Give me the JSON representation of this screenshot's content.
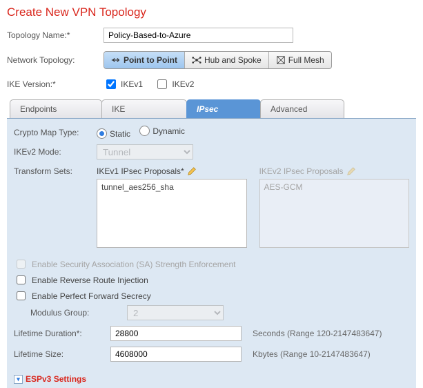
{
  "title": "Create New VPN Topology",
  "formlabels": {
    "topology_name": "Topology Name:*",
    "network_topology": "Network Topology:",
    "ike_version": "IKE Version:*"
  },
  "topology_name_value": "Policy-Based-to-Azure",
  "segments": {
    "ptp": "Point to Point",
    "hub": "Hub and Spoke",
    "full": "Full Mesh"
  },
  "ikev": {
    "v1": "IKEv1",
    "v2": "IKEv2"
  },
  "tabs": {
    "endpoints": "Endpoints",
    "ike": "IKE",
    "ipsec": "IPsec",
    "advanced": "Advanced"
  },
  "panel": {
    "crypto_map_label": "Crypto Map Type:",
    "crypto_static": "Static",
    "crypto_dynamic": "Dynamic",
    "ikev2_mode_label": "IKEv2 Mode:",
    "ikev2_mode_value": "Tunnel",
    "transform_sets_label": "Transform Sets:",
    "ikev1_prop_label": "IKEv1 IPsec Proposals*",
    "ikev2_prop_label": "IKEv2 IPsec Proposals",
    "ikev1_prop_item": "tunnel_aes256_sha",
    "ikev2_prop_item": "AES-GCM",
    "sa_enforce": "Enable Security Association (SA) Strength Enforcement",
    "rri": "Enable Reverse Route Injection",
    "pfs": "Enable Perfect Forward Secrecy",
    "modulus_label": "Modulus Group:",
    "modulus_value": "2",
    "lifetime_dur_label": "Lifetime Duration*:",
    "lifetime_dur_value": "28800",
    "lifetime_dur_unit": "Seconds (Range 120-2147483647)",
    "lifetime_size_label": "Lifetime Size:",
    "lifetime_size_value": "4608000",
    "lifetime_size_unit": "Kbytes (Range 10-2147483647)",
    "espv3": "ESPv3 Settings"
  }
}
